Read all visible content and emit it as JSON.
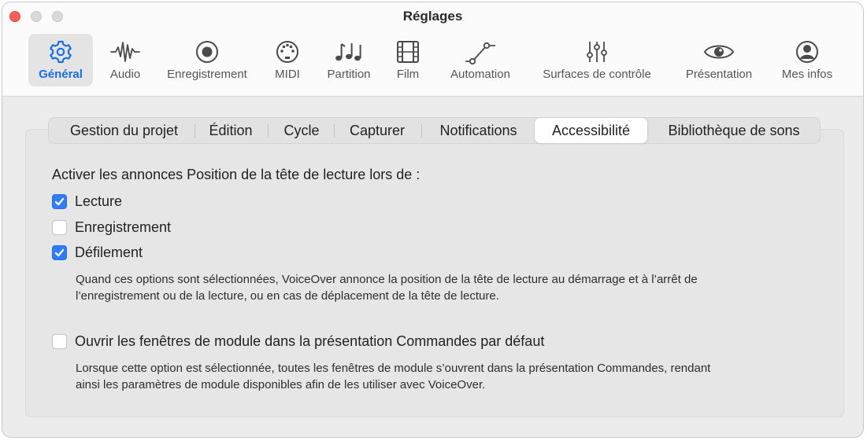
{
  "window": {
    "title": "Réglages"
  },
  "toolbar": {
    "items": [
      {
        "label": "Général",
        "icon": "gear-icon",
        "active": true
      },
      {
        "label": "Audio",
        "icon": "waveform-icon"
      },
      {
        "label": "Enregistrement",
        "icon": "record-icon"
      },
      {
        "label": "MIDI",
        "icon": "midi-port-icon"
      },
      {
        "label": "Partition",
        "icon": "music-notes-icon"
      },
      {
        "label": "Film",
        "icon": "film-icon"
      },
      {
        "label": "Automation",
        "icon": "automation-curve-icon"
      },
      {
        "label": "Surfaces de contrôle",
        "icon": "sliders-icon"
      },
      {
        "label": "Présentation",
        "icon": "eye-icon"
      },
      {
        "label": "Mes infos",
        "icon": "person-icon"
      }
    ]
  },
  "tabs": [
    {
      "label": "Gestion du projet"
    },
    {
      "label": "Édition"
    },
    {
      "label": "Cycle"
    },
    {
      "label": "Capturer"
    },
    {
      "label": "Notifications"
    },
    {
      "label": "Accessibilité",
      "selected": true
    },
    {
      "label": "Bibliothèque de sons"
    }
  ],
  "content": {
    "heading": "Activer les annonces Position de la tête de lecture lors de :",
    "options": [
      {
        "label": "Lecture",
        "checked": true
      },
      {
        "label": "Enregistrement",
        "checked": false
      },
      {
        "label": "Défilement",
        "checked": true
      }
    ],
    "options_description_line1": "Quand ces options sont sélectionnées, VoiceOver annonce la position de la tête de lecture au démarrage et à l’arrêt de",
    "options_description_line2": "l’enregistrement ou de la lecture, ou en cas de déplacement de la tête de lecture.",
    "plugin_option": {
      "label": "Ouvrir les fenêtres de module dans la présentation Commandes par défaut",
      "checked": false
    },
    "plugin_description_line1": "Lorsque cette option est sélectionnée, toutes les fenêtres de module s’ouvrent dans la présentation Commandes, rendant",
    "plugin_description_line2": "ainsi les paramètres de module disponibles afin de les utiliser avec VoiceOver."
  },
  "colors": {
    "accent": "#2f7cf6",
    "active_label": "#1a6fe0",
    "close": "#fe5f57"
  }
}
